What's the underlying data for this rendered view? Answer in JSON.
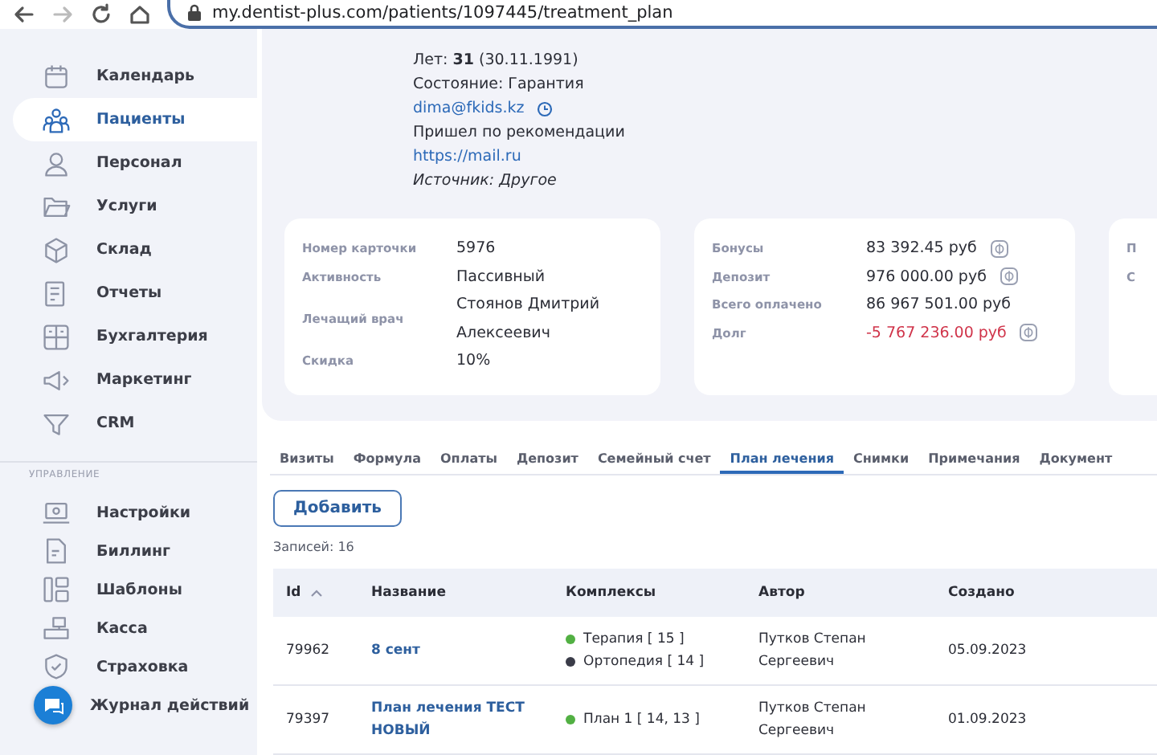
{
  "browser": {
    "url": "my.dentist-plus.com/patients/1097445/treatment_plan",
    "forward_disabled": true
  },
  "sidebar": {
    "items": [
      {
        "label": "Календарь",
        "selected": false
      },
      {
        "label": "Пациенты",
        "selected": true
      },
      {
        "label": "Персонал",
        "selected": false
      },
      {
        "label": "Услуги",
        "selected": false
      },
      {
        "label": "Склад",
        "selected": false
      },
      {
        "label": "Отчеты",
        "selected": false
      },
      {
        "label": "Бухгалтерия",
        "selected": false
      },
      {
        "label": "Маркетинг",
        "selected": false
      },
      {
        "label": "CRM",
        "selected": false
      }
    ],
    "section_title": "УПРАВЛЕНИЕ",
    "admin_items": [
      {
        "label": "Настройки",
        "selected": false
      },
      {
        "label": "Биллинг",
        "selected": false
      },
      {
        "label": "Шаблоны",
        "selected": false
      },
      {
        "label": "Касса",
        "selected": false
      },
      {
        "label": "Страховка",
        "selected": false
      },
      {
        "label": "Журнал действий",
        "selected": false
      }
    ]
  },
  "patient": {
    "lines": [
      {
        "kind": "text",
        "text": "Лет: **31** (30.11.1991)"
      },
      {
        "kind": "text",
        "text": "Состояние: Гарантия"
      },
      {
        "kind": "email",
        "text": "dima@fkids.kz"
      },
      {
        "kind": "text",
        "text": "Пришел по рекомендации"
      },
      {
        "kind": "link",
        "text": "https://mail.ru"
      },
      {
        "kind": "source",
        "text": "Источник: Другое"
      }
    ]
  },
  "cards": [
    {
      "rows": [
        {
          "label": "Номер карточки",
          "value": "5976",
          "negative": false,
          "coin": false
        },
        {
          "label": "Активность",
          "value": "Пассивный",
          "negative": false,
          "coin": false
        },
        {
          "label": "Лечащий врач",
          "value": "Стоянов Дмитрий Алексеевич",
          "negative": false,
          "coin": false
        },
        {
          "label": "Скидка",
          "value": "10%",
          "negative": false,
          "coin": false
        }
      ]
    },
    {
      "rows": [
        {
          "label": "Бонусы",
          "value": "83 392.45 руб",
          "negative": false,
          "coin": true
        },
        {
          "label": "Депозит",
          "value": "976 000.00 руб",
          "negative": false,
          "coin": true
        },
        {
          "label": "Всего оплачено",
          "value": "86 967 501.00 руб",
          "negative": false,
          "coin": false
        },
        {
          "label": "Долг",
          "value": "-5 767 236.00 руб",
          "negative": true,
          "coin": true
        }
      ]
    },
    {
      "rows": [
        {
          "label": "П"
        },
        {
          "label": "С"
        }
      ]
    }
  ],
  "tabs": [
    {
      "label": "Визиты",
      "selected": false
    },
    {
      "label": "Формула",
      "selected": false
    },
    {
      "label": "Оплаты",
      "selected": false
    },
    {
      "label": "Депозит",
      "selected": false
    },
    {
      "label": "Семейный счет",
      "selected": false
    },
    {
      "label": "План лечения",
      "selected": true
    },
    {
      "label": "Снимки",
      "selected": false
    },
    {
      "label": "Примечания",
      "selected": false
    },
    {
      "label": "Документ",
      "selected": false
    }
  ],
  "add_button": "Добавить",
  "records": "Записей: 16",
  "table": {
    "columns": [
      "Id",
      "Название",
      "Комплексы",
      "Автор",
      "Создано"
    ],
    "rows": [
      {
        "id": "79962",
        "name": "8 сент",
        "complexes": [
          {
            "text": "Терапия [ 15 ]",
            "color": "#52b043"
          },
          {
            "text": "Ортопедия [ 14 ]",
            "color": "#3a3c48"
          }
        ],
        "author": "Путков Степан Сергеевич",
        "created": "05.09.2023"
      },
      {
        "id": "79397",
        "name": "План лечения ТЕСТ НОВЫЙ",
        "complexes": [
          {
            "text": "План 1 [ 14, 13 ]",
            "color": "#52b043"
          }
        ],
        "author": "Путков Степан Сергеевич",
        "created": "01.09.2023"
      }
    ]
  }
}
